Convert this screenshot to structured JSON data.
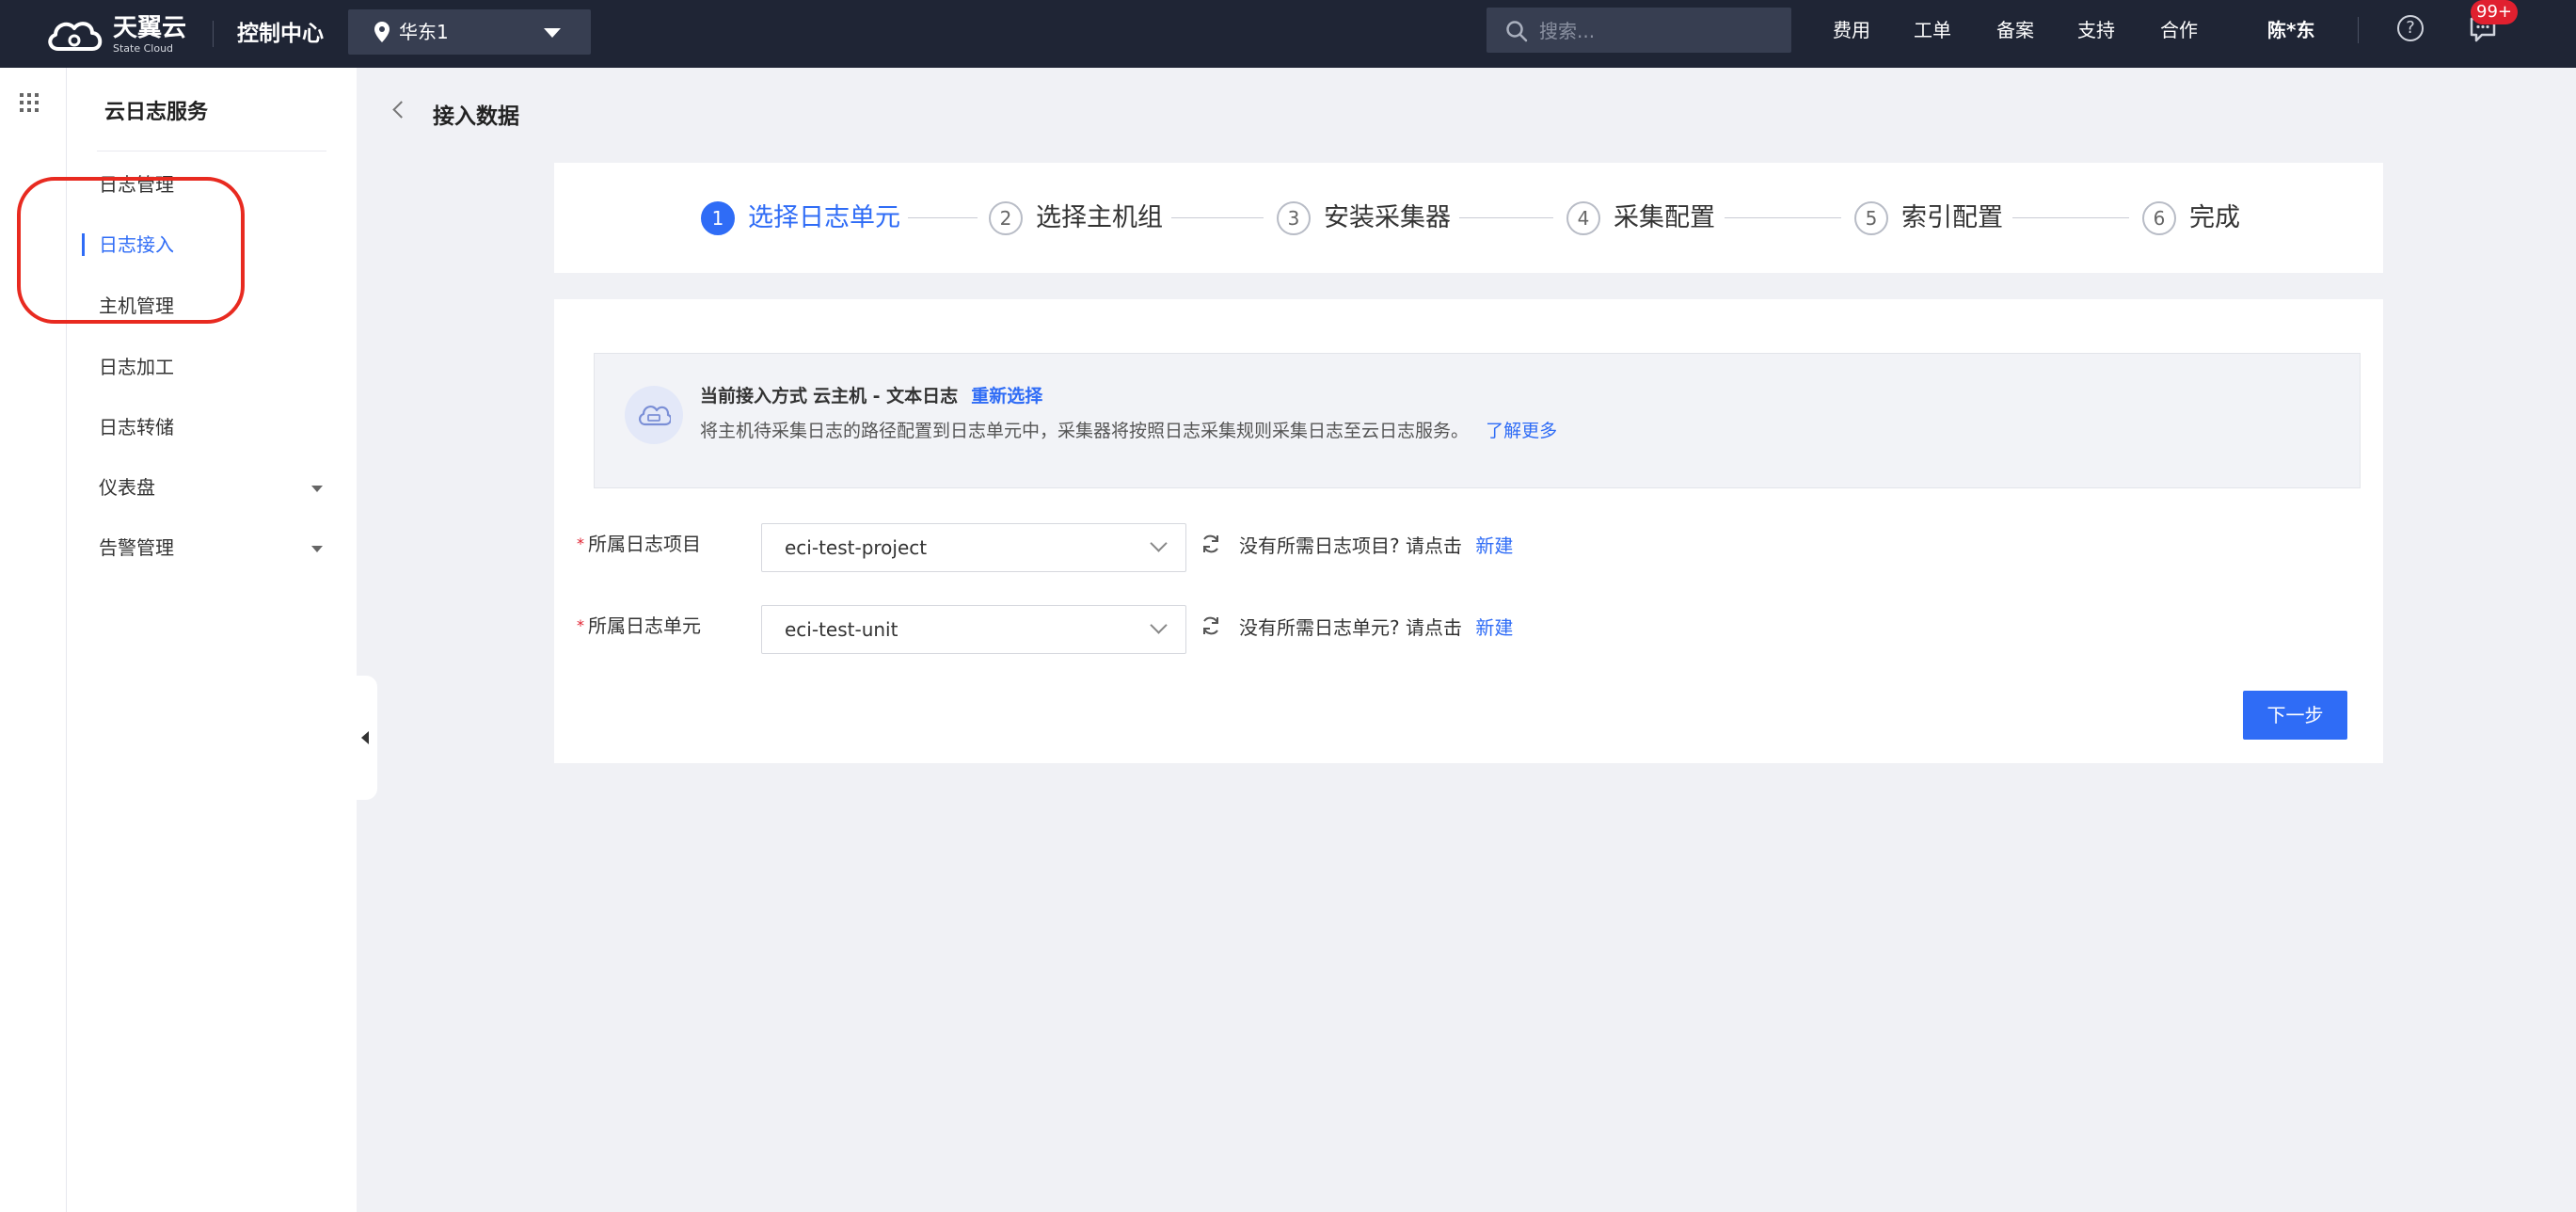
{
  "topbar": {
    "brand": "天翼云",
    "brand_sub": "State Cloud",
    "console_title": "控制中心",
    "region": "华东1",
    "search_placeholder": "搜索...",
    "nav": [
      "费用",
      "工单",
      "备案",
      "支持",
      "合作"
    ],
    "user": "陈*东",
    "message_badge": "99+"
  },
  "sidebar": {
    "title": "云日志服务",
    "items": [
      {
        "label": "日志管理"
      },
      {
        "label": "日志接入",
        "active": true
      },
      {
        "label": "主机管理"
      },
      {
        "label": "日志加工"
      },
      {
        "label": "日志转储"
      },
      {
        "label": "仪表盘",
        "expandable": true
      },
      {
        "label": "告警管理",
        "expandable": true
      }
    ]
  },
  "page": {
    "title": "接入数据"
  },
  "steps": [
    {
      "num": "1",
      "label": "选择日志单元",
      "active": true
    },
    {
      "num": "2",
      "label": "选择主机组"
    },
    {
      "num": "3",
      "label": "安装采集器"
    },
    {
      "num": "4",
      "label": "采集配置"
    },
    {
      "num": "5",
      "label": "索引配置"
    },
    {
      "num": "6",
      "label": "完成"
    }
  ],
  "info": {
    "mode_prefix": "当前接入方式",
    "mode_value": "云主机 - 文本日志",
    "reselect_link": "重新选择",
    "description": "将主机待采集日志的路径配置到日志单元中，采集器将按照日志采集规则采集日志至云日志服务。",
    "learn_more_link": "了解更多"
  },
  "form": {
    "project": {
      "label": "所属日志项目",
      "value": "eci-test-project",
      "hint": "没有所需日志项目? 请点击",
      "create_link": "新建"
    },
    "unit": {
      "label": "所属日志单元",
      "value": "eci-test-unit",
      "hint": "没有所需日志单元? 请点击",
      "create_link": "新建"
    },
    "next_button": "下一步"
  },
  "colors": {
    "topbar_bg": "#1f2535",
    "accent": "#2f6cf6",
    "annotation": "#e82a20",
    "badge": "#e0202f"
  }
}
